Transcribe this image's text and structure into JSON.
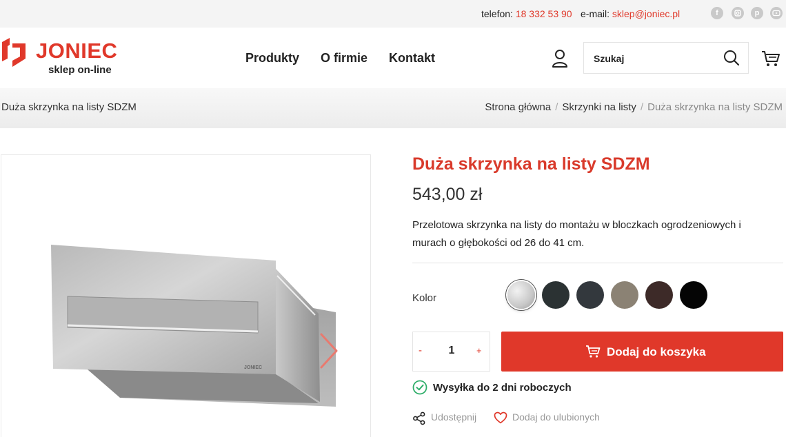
{
  "topbar": {
    "phone_label": "telefon:",
    "phone_value": "18 332 53 90",
    "email_label": "e-mail:",
    "email_value": "sklep@joniec.pl",
    "social": [
      "facebook-icon",
      "instagram-icon",
      "pinterest-icon",
      "youtube-icon"
    ]
  },
  "brand": {
    "name": "JONIEC",
    "tagline": "sklep on-line",
    "color": "#e0382a"
  },
  "nav": [
    "Produkty",
    "O firmie",
    "Kontakt"
  ],
  "search": {
    "placeholder": "Szukaj"
  },
  "breadcrumb": {
    "page_title": "Duża skrzynka na listy SDZM",
    "items": [
      "Strona główna",
      "Skrzynki na listy",
      "Duża skrzynka na listy SDZM"
    ]
  },
  "product": {
    "title": "Duża skrzynka na listy SDZM",
    "price": "543,00 zł",
    "description_1": "Przelotowa skrzynka na listy do montażu w bloczkach ogrodzeniowych i murach o głębokości od ",
    "depth_from": "26",
    "description_2": " do ",
    "depth_to": "41",
    "description_3": " cm.",
    "image_mark": "JONIEC",
    "color_label": "Kolor",
    "colors": [
      "#c8c8c8",
      "#2b3233",
      "#33383d",
      "#8b8274",
      "#3d2a28",
      "#050505"
    ],
    "selected_color_index": 0,
    "quantity": "1",
    "minus": "-",
    "plus": "+",
    "add_to_cart": "Dodaj do koszyka",
    "shipping": "Wysyłka do 2 dni roboczych",
    "share": "Udostępnij",
    "favorite": "Dodaj do ulubionych"
  }
}
